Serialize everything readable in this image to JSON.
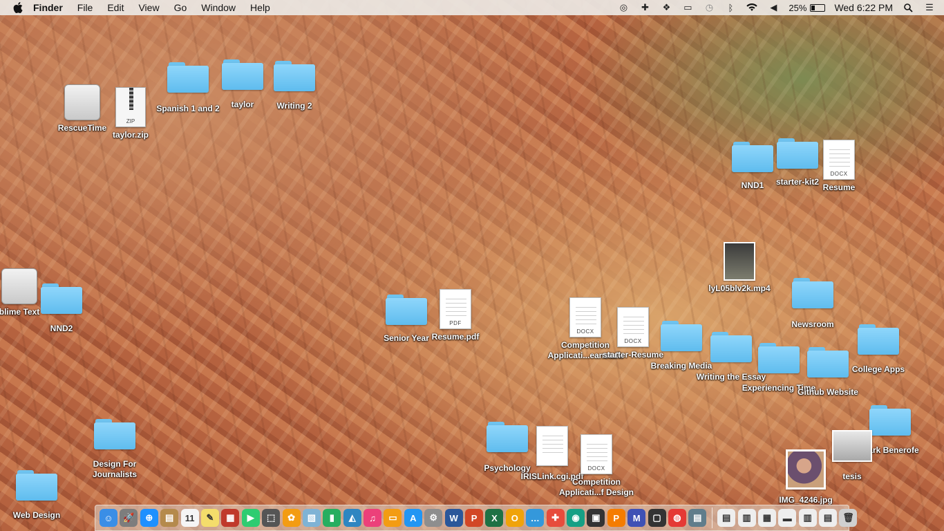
{
  "menubar": {
    "app_name": "Finder",
    "menus": [
      "File",
      "Edit",
      "View",
      "Go",
      "Window",
      "Help"
    ],
    "battery": "25%",
    "clock": "Wed 6:22 PM"
  },
  "desktop": {
    "rescuetime": "RescueTime",
    "taylor_zip": "taylor.zip",
    "taylor_zip_tag": "ZIP",
    "spanish": "Spanish 1 and 2",
    "taylor": "taylor",
    "writing2": "Writing 2",
    "nnd1": "NND1",
    "starter_kit2": "starter-kit2",
    "resume": "Resume",
    "mp4": "lyL05blv2k.mp4",
    "sublime": "blime Text",
    "nnd2": "NND2",
    "newsroom": "Newsroom",
    "senior_year": "Senior Year",
    "resume_pdf": "Resume.pdf",
    "competition1_line1": "Competition",
    "competition1_line2": "Applicati...eanstalk",
    "starter_resume": "starter-Resume",
    "breaking_media": "Breaking Media",
    "writing_essay": "Writing the Essay",
    "experiencing_time": "Experiencing Time",
    "github_website": "Github Website",
    "college_apps": "College Apps",
    "design_line1": "Design For",
    "design_line2": "Journalists",
    "psychology": "Psychology",
    "iris_link": "IRISLink.cgi.pdf",
    "competition2_line1": "Competition",
    "competition2_line2": "Applicati...f Design",
    "mark_benerofe": "Mark Benerofe",
    "tesis": "tesis",
    "img4246": "IMG_4246.jpg",
    "web_design": "Web Design",
    "docx_tag": "DOCX",
    "pdf_tag": "PDF"
  },
  "dock": {
    "items": [
      {
        "name": "finder",
        "glyph": "☺",
        "color": "#3a8ee6"
      },
      {
        "name": "launchpad",
        "glyph": "🚀",
        "color": "#7d7d7d"
      },
      {
        "name": "safari",
        "glyph": "⊕",
        "color": "#1e90ff"
      },
      {
        "name": "contacts",
        "glyph": "▤",
        "color": "#b58a4c"
      },
      {
        "name": "calendar",
        "glyph": "11",
        "color": "#f5f5f5"
      },
      {
        "name": "notes",
        "glyph": "✎",
        "color": "#f4dd6b"
      },
      {
        "name": "photo-booth",
        "glyph": "▦",
        "color": "#c0392b"
      },
      {
        "name": "facetime",
        "glyph": "▶",
        "color": "#2ecc71"
      },
      {
        "name": "messages",
        "glyph": "⬚",
        "color": "#555"
      },
      {
        "name": "photos",
        "glyph": "✿",
        "color": "#f39c12"
      },
      {
        "name": "preview",
        "glyph": "▧",
        "color": "#7fb3d5"
      },
      {
        "name": "numbers",
        "glyph": "▮",
        "color": "#27ae60"
      },
      {
        "name": "keynote",
        "glyph": "◭",
        "color": "#2e86c1"
      },
      {
        "name": "itunes",
        "glyph": "♫",
        "color": "#ec407a"
      },
      {
        "name": "ibooks",
        "glyph": "▭",
        "color": "#f39c12"
      },
      {
        "name": "app-store",
        "glyph": "A",
        "color": "#2196f3"
      },
      {
        "name": "system-preferences",
        "glyph": "⚙",
        "color": "#8e8e8e"
      },
      {
        "name": "word",
        "glyph": "W",
        "color": "#2b579a"
      },
      {
        "name": "powerpoint",
        "glyph": "P",
        "color": "#d24726"
      },
      {
        "name": "excel",
        "glyph": "X",
        "color": "#1e7145"
      },
      {
        "name": "outlook",
        "glyph": "O",
        "color": "#f0a30a"
      },
      {
        "name": "messenger",
        "glyph": "…",
        "color": "#3498db"
      },
      {
        "name": "rescuetime",
        "glyph": "✚",
        "color": "#e74c3c"
      },
      {
        "name": "globe",
        "glyph": "◉",
        "color": "#16a085"
      },
      {
        "name": "terminal",
        "glyph": "▣",
        "color": "#333"
      },
      {
        "name": "pages",
        "glyph": "P",
        "color": "#f57c00"
      },
      {
        "name": "maps",
        "glyph": "M",
        "color": "#3f51b5"
      },
      {
        "name": "slack",
        "glyph": "▢",
        "color": "#333"
      },
      {
        "name": "chrome",
        "glyph": "◍",
        "color": "#e53935"
      },
      {
        "name": "drive",
        "glyph": "▤",
        "color": "#607d8b"
      }
    ],
    "trailing": [
      {
        "name": "document-1",
        "glyph": "▤",
        "color": "#eee"
      },
      {
        "name": "document-2",
        "glyph": "▥",
        "color": "#eee"
      },
      {
        "name": "document-3",
        "glyph": "▦",
        "color": "#eee"
      },
      {
        "name": "document-4",
        "glyph": "▬",
        "color": "#eee"
      },
      {
        "name": "document-5",
        "glyph": "▥",
        "color": "#eee"
      },
      {
        "name": "document-6",
        "glyph": "▤",
        "color": "#eee"
      },
      {
        "name": "trash",
        "glyph": "🗑",
        "color": "#d0d0d0"
      }
    ]
  }
}
